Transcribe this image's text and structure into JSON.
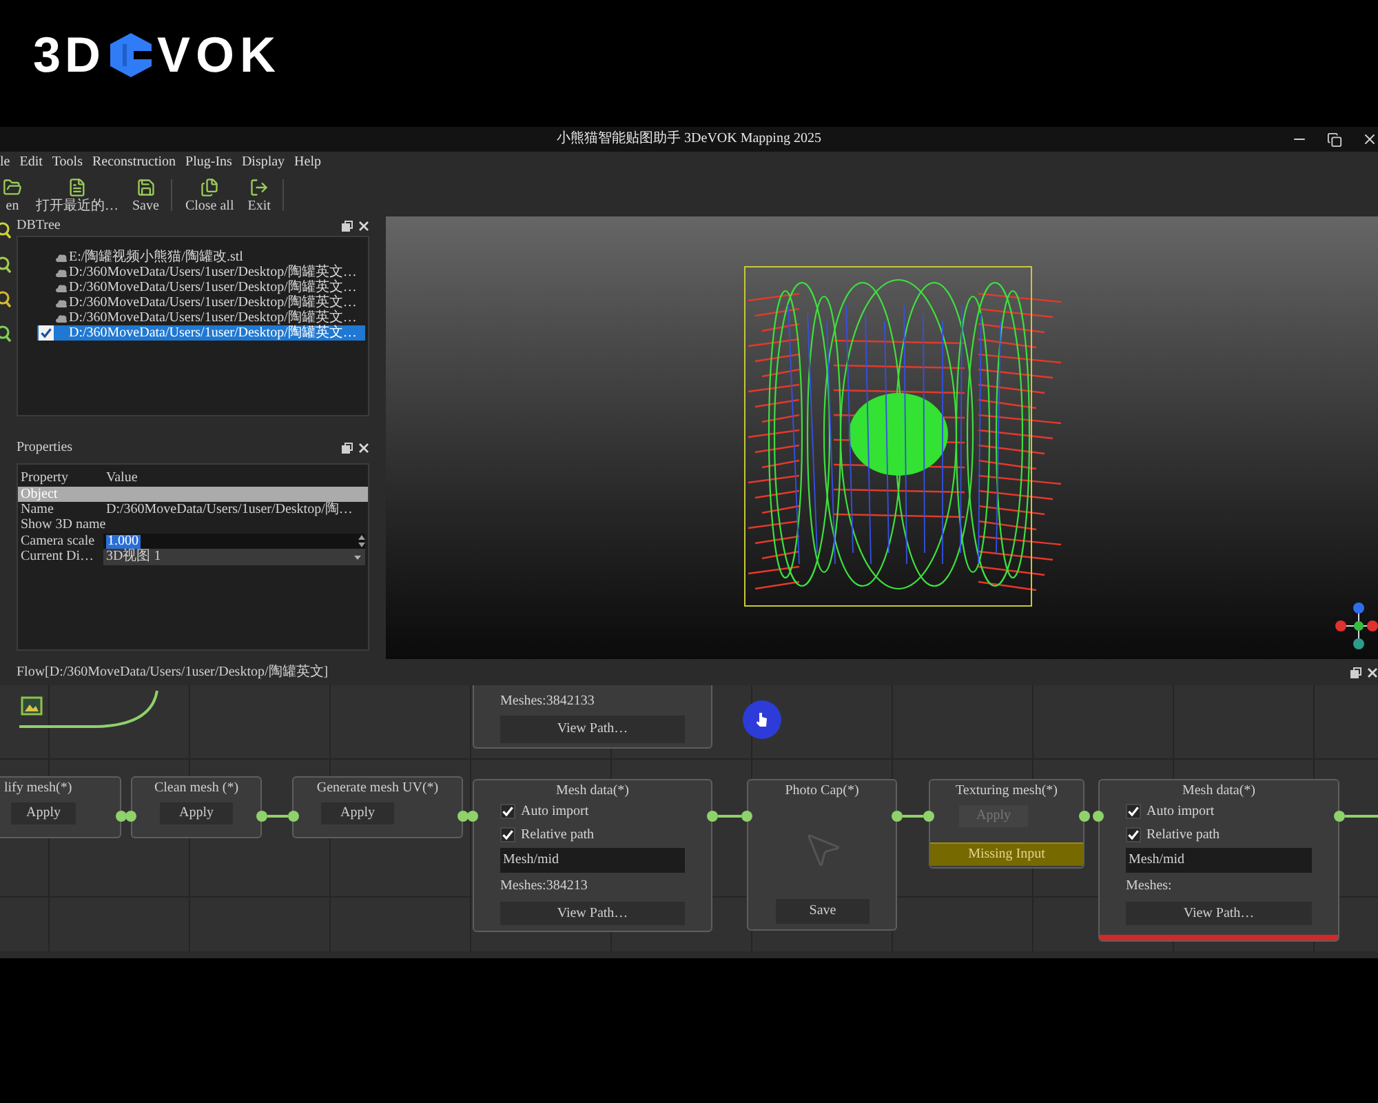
{
  "logo": {
    "left": "3D",
    "right": "VOK"
  },
  "window": {
    "title": "小熊猫智能贴图助手 3DeVOK Mapping 2025"
  },
  "menu": [
    "le",
    "Edit",
    "Tools",
    "Reconstruction",
    "Plug-Ins",
    "Display",
    "Help"
  ],
  "toolbar": [
    [
      {
        "label": "en",
        "kind": "open"
      },
      {
        "label": "打开最近的…",
        "kind": "recent"
      },
      {
        "label": "Save",
        "kind": "save"
      }
    ],
    [
      {
        "label": "Close all",
        "kind": "close_all"
      },
      {
        "label": "Exit",
        "kind": "exit"
      }
    ]
  ],
  "dbtree": {
    "title": "DBTree",
    "items": [
      {
        "label": "E:/陶罐视频小熊猫/陶罐改.stl",
        "kind": "mesh",
        "selected": false
      },
      {
        "label": "D:/360MoveData/Users/1user/Desktop/陶罐英文…",
        "kind": "mesh",
        "selected": false
      },
      {
        "label": "D:/360MoveData/Users/1user/Desktop/陶罐英文…",
        "kind": "mesh",
        "selected": false
      },
      {
        "label": "D:/360MoveData/Users/1user/Desktop/陶罐英文…",
        "kind": "mesh",
        "selected": false
      },
      {
        "label": "D:/360MoveData/Users/1user/Desktop/陶罐英文…",
        "kind": "mesh",
        "selected": false
      },
      {
        "label": "D:/360MoveData/Users/1user/Desktop/陶罐英文…",
        "kind": "checkbox",
        "checked": true,
        "selected": true
      }
    ]
  },
  "properties": {
    "title": "Properties",
    "columns": [
      "Property",
      "Value"
    ],
    "rows": [
      {
        "kind": "section",
        "label": "Object"
      },
      {
        "kind": "text",
        "property": "Name",
        "value": "D:/360MoveData/Users/1user/Desktop/陶…"
      },
      {
        "kind": "text",
        "property": "Show 3D name"
      },
      {
        "kind": "spin",
        "property": "Camera scale",
        "value": "1.000",
        "text_selected": true
      },
      {
        "kind": "select",
        "property": "Current Di…",
        "value": "3D视图 1"
      }
    ]
  },
  "flow": {
    "title": "Flow[D:/360MoveData/Users/1user/Desktop/陶罐英文]",
    "nodes": [
      {
        "kind": "summary",
        "meshes": "Meshes:3842133",
        "button": "View Path…"
      },
      {
        "kind": "action",
        "title": "lify mesh(*)",
        "button": "Apply",
        "disabled": false
      },
      {
        "kind": "action",
        "title": "Clean mesh (*)",
        "button": "Apply",
        "disabled": false
      },
      {
        "kind": "action",
        "title": "Generate mesh UV(*)",
        "button": "Apply",
        "disabled": false
      },
      {
        "kind": "mesh_data",
        "title": "Mesh data(*)",
        "options": [
          {
            "label": "Auto import",
            "checked": true
          },
          {
            "label": "Relative path",
            "checked": true
          }
        ],
        "path": "Mesh/mid",
        "meshes": "Meshes:384213",
        "button": "View Path…",
        "error": false
      },
      {
        "kind": "capture",
        "title": "Photo Cap(*)",
        "button": "Save"
      },
      {
        "kind": "action",
        "title": "Texturing mesh(*)",
        "button": "Apply",
        "disabled": true,
        "warning": "Missing Input"
      },
      {
        "kind": "mesh_data",
        "title": "Mesh data(*)",
        "options": [
          {
            "label": "Auto import",
            "checked": true
          },
          {
            "label": "Relative path",
            "checked": true
          }
        ],
        "path": "Mesh/mid",
        "meshes": "Meshes:",
        "button": "View Path…",
        "error": true
      }
    ]
  }
}
